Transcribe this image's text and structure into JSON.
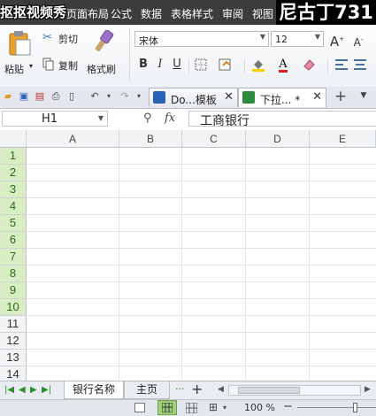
{
  "watermark": {
    "left": "抠抠视频秀",
    "right": "尼古丁731"
  },
  "menu": {
    "items": [
      "页面布局",
      "公式",
      "数据",
      "表格样式",
      "审阅",
      "视图"
    ]
  },
  "ribbon": {
    "clipboard": {
      "cut": "剪切",
      "paste": "粘贴",
      "copy": "复制",
      "format_painter": "格式刷"
    },
    "font": {
      "name": "宋体",
      "size": "12",
      "bold": "B",
      "italic": "I",
      "underline": "U",
      "grow": "A",
      "shrink": "A"
    }
  },
  "tabs": [
    {
      "label": "Do...模板",
      "icon_color": "#2b63b8"
    },
    {
      "label": "下拉... *",
      "icon_color": "#2d8a3a"
    }
  ],
  "formula_bar": {
    "cell_ref": "H1",
    "fx": "fx",
    "value": "工商银行"
  },
  "columns": [
    "A",
    "B",
    "C",
    "D",
    "E"
  ],
  "rows": [
    "1",
    "2",
    "3",
    "4",
    "5",
    "6",
    "7",
    "8",
    "9",
    "10",
    "11",
    "12",
    "13",
    "14"
  ],
  "selected_rows": 10,
  "sheets": {
    "active": "银行名称",
    "other": "主页",
    "more": "···",
    "add": "+"
  },
  "status": {
    "zoom": "100 %"
  },
  "colors": {
    "menu_bg": "#3c3c3c",
    "selected_row_bg": "#d9edc5",
    "accent_green": "#2f8f2f"
  }
}
